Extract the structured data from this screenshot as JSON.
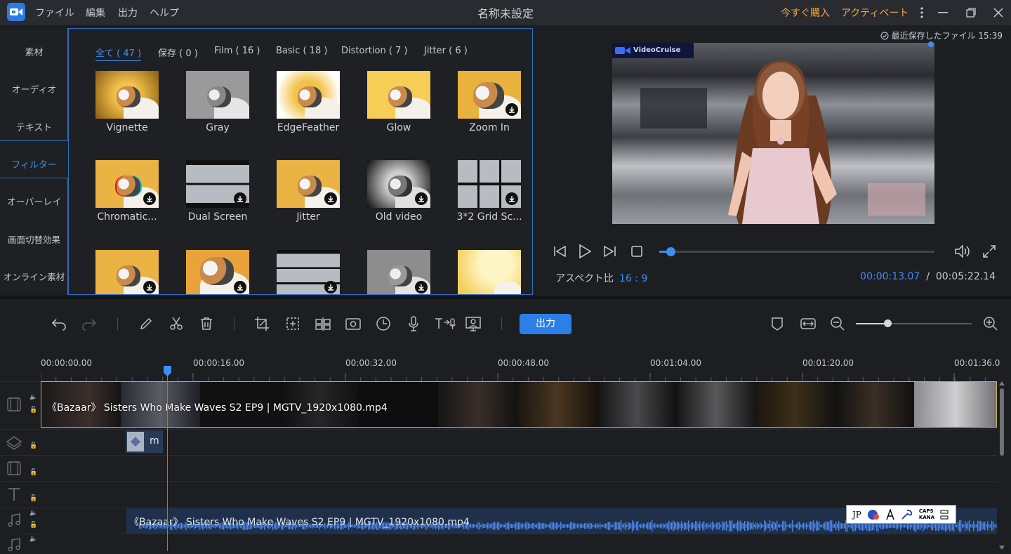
{
  "menu": [
    "ファイル",
    "編集",
    "出力",
    "ヘルプ"
  ],
  "window_title": "名称未設定",
  "buy_label": "今すぐ購入",
  "activate_label": "アクティベート",
  "nav": [
    "素材",
    "オーディオ",
    "テキスト",
    "フィルター",
    "オーバーレイ",
    "画面切替効果",
    "オンライン素材"
  ],
  "active_nav": "フィルター",
  "filter_tabs": [
    "全て ( 47 )",
    "保存 ( 0 )",
    "Film ( 16 )",
    "Basic ( 18 )",
    "Distortion ( 7 )",
    "Jitter ( 6 )"
  ],
  "filters_row1": [
    "Vignette",
    "Gray",
    "EdgeFeather",
    "Glow",
    "Zoom In"
  ],
  "filters_row2": [
    "Chromatic...",
    "Dual Screen",
    "Jitter",
    "Old video",
    "3*2 Grid Sc..."
  ],
  "preview": {
    "saved": "最近保存したファイル 15:39",
    "watermark": "VideoCruise",
    "aspect_label": "アスペクト比",
    "aspect_value": "16 : 9",
    "time_current": "00:00:13.07",
    "time_sep": "/",
    "time_total": "00:05:22.14",
    "progress_fraction": 0.04
  },
  "toolbar": {
    "export_label": "出力",
    "zoom_fraction": 0.27
  },
  "ruler": [
    "00:00:00.00",
    "00:00:16.00",
    "00:00:32.00",
    "00:00:48.00",
    "00:01:04.00",
    "00:01:20.00",
    "00:01:36.0"
  ],
  "clips": {
    "video": "《Bazaar》 Sisters Who Make Waves S2 EP9 | MGTV_1920x1080.mp4",
    "overlay": "m",
    "audio": "《Bazaar》 Sisters Who Make Waves S2 EP9 | MGTV_1920x1080.mp4"
  },
  "ime": {
    "lang": "JP",
    "caps": "CAPS",
    "kana": "KANA"
  },
  "colors": {
    "accent": "#3d8ef0",
    "orange": "#f2a23c",
    "export_bg": "#2b7fe6"
  }
}
